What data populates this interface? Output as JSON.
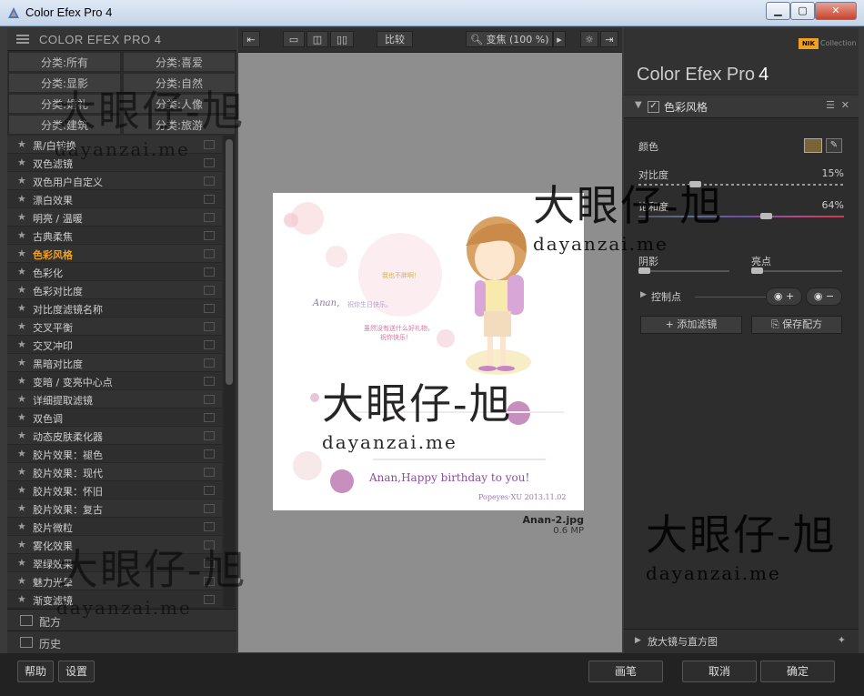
{
  "window": {
    "title": "Color Efex Pro 4",
    "min": "▁",
    "max": "▢",
    "close": "✕"
  },
  "left_panel": {
    "header": "COLOR EFEX PRO 4",
    "categories": [
      "分类:所有",
      "分类:喜爱",
      "分类:显影",
      "分类:自然",
      "分类:婚礼",
      "分类:人像",
      "分类:建筑",
      "分类:旅游"
    ],
    "filters": [
      "黑/白转换",
      "双色滤镜",
      "双色用户自定义",
      "漂白效果",
      "明亮 / 温暖",
      "古典柔焦",
      "色彩风格",
      "色彩化",
      "色彩对比度",
      "对比度滤镜名称",
      "交叉平衡",
      "交叉冲印",
      "黑暗对比度",
      "变暗 / 变亮中心点",
      "详细提取滤镜",
      "双色调",
      "动态皮肤柔化器",
      "胶片效果：褪色",
      "胶片效果：现代",
      "胶片效果：怀旧",
      "胶片效果：复古",
      "胶片微粒",
      "雾化效果",
      "翠绿效果",
      "魅力光晕",
      "渐变滤镜"
    ],
    "active_filter": "色彩风格",
    "footer": [
      "配方",
      "历史"
    ]
  },
  "toolbar": {
    "compare": "比较",
    "zoom": "变焦 (100 %)"
  },
  "image": {
    "filename": "Anan-2.jpg",
    "size": "0.6 MP",
    "card_title": "Anan,Happy birthday to you!",
    "card_sign": "Popeyes·XU  2013.11.02",
    "card_name": "Anan,",
    "card_note1": "祝你生日快乐。",
    "card_note2": "我也不胖啊！",
    "card_note3": "虽然没有送什么好礼物，",
    "card_note4": "祝你快乐！"
  },
  "right_panel": {
    "brand_nik": "NIK",
    "brand_collection": "Collection",
    "title": "Color Efex Pro",
    "version": "4",
    "filter_name": "色彩风格",
    "color_label": "颜色",
    "contrast": {
      "label": "对比度",
      "value": "15%"
    },
    "saturation": {
      "label": "饱和度",
      "value": "64%"
    },
    "shadows": {
      "label": "阴影"
    },
    "highlights": {
      "label": "亮点"
    },
    "control_points": "控制点",
    "add_filter": "添加滤镜",
    "save_recipe": "保存配方",
    "loupe": "放大镜与直方图"
  },
  "bottom": {
    "help": "帮助",
    "settings": "设置",
    "brush": "画笔",
    "cancel": "取消",
    "ok": "确定"
  },
  "watermark": {
    "big": "大眼仔-旭",
    "small": "dayanzai.me"
  },
  "colors": {
    "accent": "#f0a020",
    "panel": "#2b2b2b",
    "canvas": "#8e8e8e",
    "swatch": "#7a6436"
  }
}
